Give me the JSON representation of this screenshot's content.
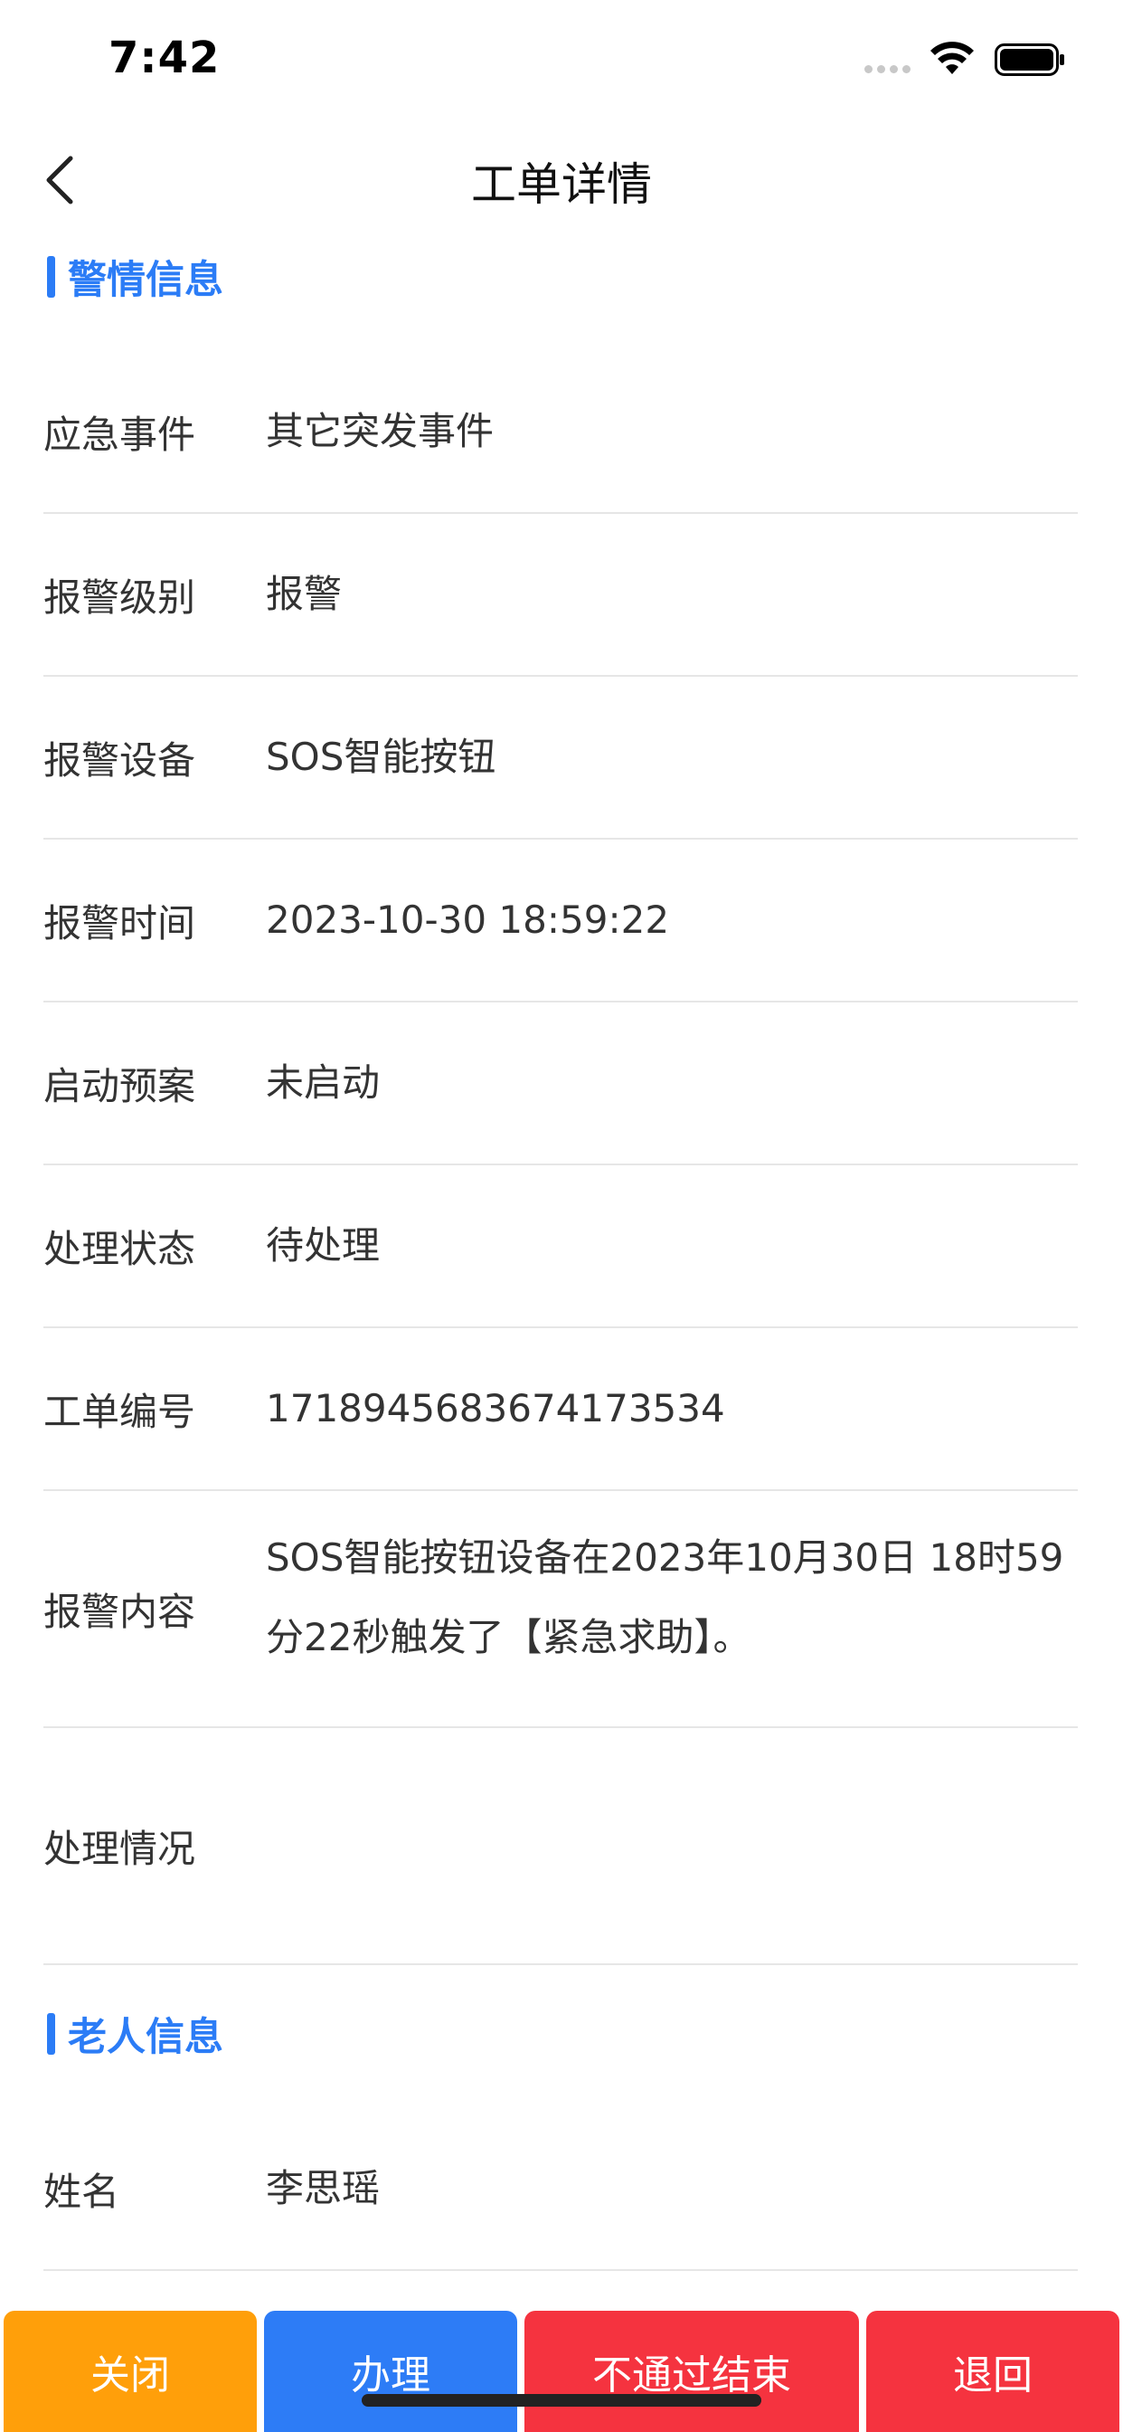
{
  "status_bar": {
    "time": "7:42"
  },
  "nav": {
    "title": "工单详情"
  },
  "alarm_section": {
    "title": "警情信息",
    "rows": [
      {
        "label": "应急事件",
        "value": "其它突发事件"
      },
      {
        "label": "报警级别",
        "value": "报警"
      },
      {
        "label": "报警设备",
        "value": "SOS智能按钮"
      },
      {
        "label": "报警时间",
        "value": "2023-10-30 18:59:22"
      },
      {
        "label": "启动预案",
        "value": "未启动"
      },
      {
        "label": "处理状态",
        "value": "待处理"
      },
      {
        "label": "工单编号",
        "value": "1718945683674173534"
      },
      {
        "label": "报警内容",
        "value": "SOS智能按钮设备在2023年10月30日 18时59分22秒触发了【紧急求助】。"
      },
      {
        "label": "处理情况",
        "value": ""
      }
    ]
  },
  "elder_section": {
    "title": "老人信息",
    "rows": [
      {
        "label": "姓名",
        "value": "李思瑶"
      }
    ]
  },
  "actions": {
    "close_label": "关闭",
    "handle_label": "办理",
    "reject_label": "不通过结束",
    "return_label": "退回"
  },
  "colors": {
    "accent": "#2b7cf6",
    "close": "#ff9f0a",
    "handle": "#2d7cf6",
    "reject": "#f5333f",
    "return": "#f5333f"
  },
  "icons": [
    "back-icon",
    "wifi-icon",
    "battery-icon",
    "signal-icon"
  ]
}
